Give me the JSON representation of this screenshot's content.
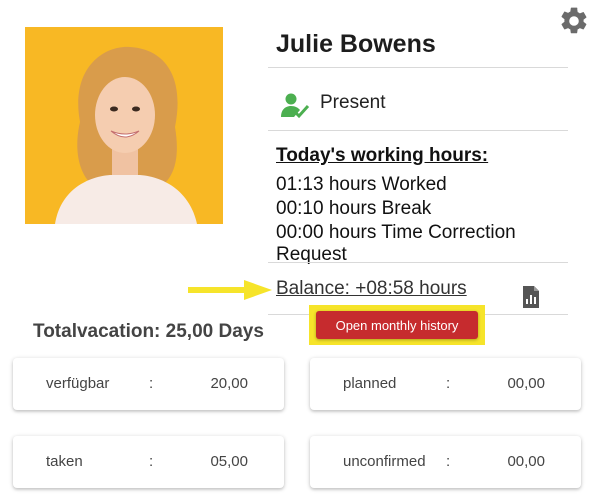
{
  "profile": {
    "name": "Julie Bowens",
    "status": "Present"
  },
  "hours": {
    "title": "Today's working hours:",
    "worked": "01:13 hours Worked",
    "break": "00:10 hours Break",
    "correction": "00:00 hours Time Correction Request"
  },
  "balance": "Balance: +08:58 hours",
  "history_button": "Open monthly history",
  "vacation": {
    "title": "Totalvacation: 25,00 Days",
    "cards": [
      {
        "label": "verfügbar",
        "separator": ":",
        "value": "20,00"
      },
      {
        "label": "planned",
        "separator": ":",
        "value": "00,00"
      },
      {
        "label": "taken",
        "separator": ":",
        "value": "05,00"
      },
      {
        "label": "unconfirmed",
        "separator": ":",
        "value": "00,00"
      }
    ]
  },
  "colors": {
    "photo_bg": "#f8b824",
    "history_button": "#c62b2e",
    "highlight": "#f6e42a",
    "present_icon": "#4caf50",
    "gear_icon": "#6b6b6b"
  },
  "icons": {
    "settings": "gear-icon",
    "presence": "person-check-icon",
    "report": "report-chart-icon",
    "annotation": "arrow-right-icon"
  }
}
